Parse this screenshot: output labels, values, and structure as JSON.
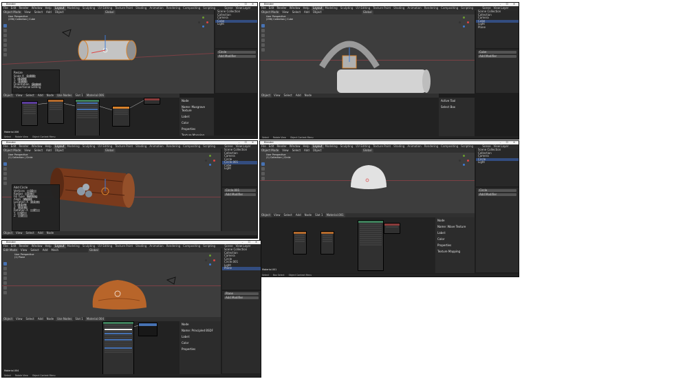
{
  "app": {
    "title": "Blender"
  },
  "menu": [
    "File",
    "Edit",
    "Render",
    "Window",
    "Help"
  ],
  "workspace_tabs": [
    "Layout",
    "Modeling",
    "Sculpting",
    "UV Editing",
    "Texture Paint",
    "Shading",
    "Animation",
    "Rendering",
    "Compositing",
    "Scripting"
  ],
  "scene_label": "Scene",
  "view_layer_label": "View Layer",
  "header": {
    "mode_object": "Object Mode",
    "mode_edit": "Edit Mode",
    "view": "View",
    "select": "Select",
    "add": "Add",
    "object": "Object",
    "mesh": "Mesh",
    "global": "Global"
  },
  "viewport_text": {
    "persp": "User Perspective",
    "collection_cube": "(298) Collection | Cube",
    "collection_circle": "(1) Collection | Circle",
    "collection_plane": "(1) Plane"
  },
  "outliner": {
    "w1": [
      "Scene Collection",
      "Collection",
      "Camera",
      "Cube",
      "Light"
    ],
    "w2": [
      "Scene Collection",
      "Collection",
      "Camera",
      "Cube",
      "Light",
      "Plane"
    ],
    "w3": [
      "Scene Collection",
      "Collection",
      "Camera",
      "Circle",
      "Circle.001",
      "Cube",
      "Light"
    ],
    "w4": [
      "Scene Collection",
      "Collection",
      "Camera",
      "Circle",
      "Light"
    ],
    "w5": [
      "Scene Collection",
      "Collection",
      "Camera",
      "Circle",
      "Circle.001",
      "Light",
      "Plane"
    ]
  },
  "props_object": {
    "w1": "Circle",
    "w2": "Cube",
    "w3": "Circle.001",
    "w4": "Circle",
    "w5": "Plane"
  },
  "add_modifier": "Add Modifier",
  "node_header": {
    "object": "Object",
    "view": "View",
    "select": "Select",
    "add": "Add",
    "node": "Node",
    "use_nodes": "Use Nodes",
    "slot": "Slot 1"
  },
  "materials": {
    "w1": "Material.006",
    "w4": "Material.001",
    "w5": "Material.004"
  },
  "node_panel": {
    "title": "Node",
    "name_label": "Name:",
    "label_label": "Label:",
    "color": "Color",
    "properties": "Properties",
    "texture_mapping": "Texture Mapping",
    "w1_name": "Musgrave Texture",
    "w4_name": "Wave Texture",
    "w5_name": "Principled BSDF"
  },
  "active_tool": {
    "title": "Active Tool",
    "select_box": "Select Box"
  },
  "op_panel_w1": {
    "title": "Resize",
    "rows": [
      [
        "Scale X",
        "1.000"
      ],
      [
        "Y",
        "0.290"
      ],
      [
        "Z",
        "1.000"
      ],
      [
        "Orientation",
        "Global"
      ],
      [
        "Proportional Editing",
        ""
      ]
    ]
  },
  "op_panel_w3": {
    "title": "Add Circle",
    "rows": [
      [
        "Vertices",
        "32"
      ],
      [
        "Radius",
        "1 m"
      ],
      [
        "Fill Type",
        "Nothing"
      ],
      [
        "Align",
        "World"
      ],
      [
        "Location X",
        "0.1 m"
      ],
      [
        "Y",
        "0.1 m"
      ],
      [
        "Z",
        "0.1 m"
      ],
      [
        "Rotation X",
        "0°"
      ],
      [
        "Y",
        "0°"
      ],
      [
        "Z",
        "0°"
      ]
    ]
  },
  "status": {
    "select": "Select",
    "box_select": "Box Select",
    "rotate_view": "Rotate View",
    "context_menu": "Object Context Menu"
  },
  "colors": {
    "orange": "#d9822b",
    "blue_sel": "#4772b3",
    "wood": "#7a3a1c",
    "bread": "#b8652a"
  },
  "icons": [
    "camera-icon",
    "light-icon",
    "mesh-icon",
    "eye-icon",
    "cursor-icon",
    "move-icon"
  ]
}
